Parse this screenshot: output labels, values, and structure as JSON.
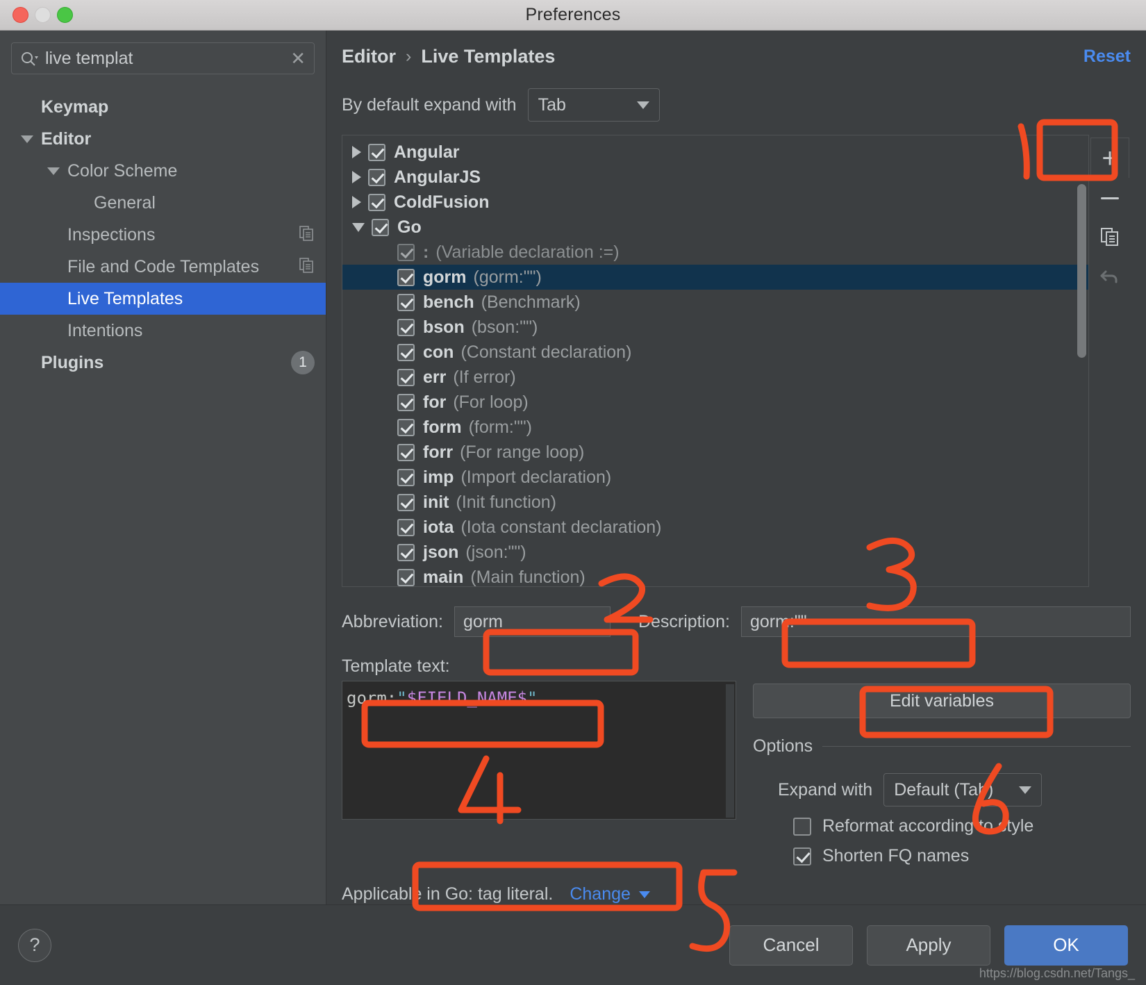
{
  "window": {
    "title": "Preferences"
  },
  "search": {
    "value": "live templat",
    "icon": "search-icon",
    "clear_icon": "clear-icon"
  },
  "sidebar": {
    "items": [
      {
        "label": "Keymap",
        "level": 0,
        "arrow": "none",
        "bold": true,
        "selected": false,
        "icon": ""
      },
      {
        "label": "Editor",
        "level": 0,
        "arrow": "down",
        "bold": true,
        "selected": false,
        "icon": ""
      },
      {
        "label": "Color Scheme",
        "level": 1,
        "arrow": "down",
        "bold": false,
        "selected": false,
        "icon": ""
      },
      {
        "label": "General",
        "level": 2,
        "arrow": "none",
        "bold": false,
        "selected": false,
        "icon": ""
      },
      {
        "label": "Inspections",
        "level": 1,
        "arrow": "none",
        "bold": false,
        "selected": false,
        "icon": "copy-icon"
      },
      {
        "label": "File and Code Templates",
        "level": 1,
        "arrow": "none",
        "bold": false,
        "selected": false,
        "icon": "copy-icon"
      },
      {
        "label": "Live Templates",
        "level": 1,
        "arrow": "none",
        "bold": false,
        "selected": true,
        "icon": ""
      },
      {
        "label": "Intentions",
        "level": 1,
        "arrow": "none",
        "bold": false,
        "selected": false,
        "icon": ""
      },
      {
        "label": "Plugins",
        "level": 0,
        "arrow": "none",
        "bold": true,
        "selected": false,
        "icon": "",
        "badge": "1"
      }
    ]
  },
  "header": {
    "breadcrumb": [
      "Editor",
      "Live Templates"
    ],
    "separator": "›",
    "reset_label": "Reset"
  },
  "expand_default": {
    "label": "By default expand with",
    "value": "Tab"
  },
  "template_list": {
    "rows": [
      {
        "arrow": "right",
        "indent": 0,
        "checked": true,
        "name": "Angular",
        "desc": "",
        "selected": false,
        "muted": false
      },
      {
        "arrow": "right",
        "indent": 0,
        "checked": true,
        "name": "AngularJS",
        "desc": "",
        "selected": false,
        "muted": false
      },
      {
        "arrow": "right",
        "indent": 0,
        "checked": true,
        "name": "ColdFusion",
        "desc": "",
        "selected": false,
        "muted": false
      },
      {
        "arrow": "down",
        "indent": 0,
        "checked": true,
        "name": "Go",
        "desc": "",
        "selected": false,
        "muted": false
      },
      {
        "arrow": "none",
        "indent": 1,
        "checked": true,
        "name": ":",
        "desc": "(Variable declaration :=)",
        "selected": false,
        "muted": true
      },
      {
        "arrow": "none",
        "indent": 1,
        "checked": true,
        "name": "gorm",
        "desc": "(gorm:\"\")",
        "selected": true,
        "muted": false
      },
      {
        "arrow": "none",
        "indent": 1,
        "checked": true,
        "name": "bench",
        "desc": "(Benchmark)",
        "selected": false,
        "muted": false
      },
      {
        "arrow": "none",
        "indent": 1,
        "checked": true,
        "name": "bson",
        "desc": "(bson:\"\")",
        "selected": false,
        "muted": false
      },
      {
        "arrow": "none",
        "indent": 1,
        "checked": true,
        "name": "con",
        "desc": "(Constant declaration)",
        "selected": false,
        "muted": false
      },
      {
        "arrow": "none",
        "indent": 1,
        "checked": true,
        "name": "err",
        "desc": "(If error)",
        "selected": false,
        "muted": false
      },
      {
        "arrow": "none",
        "indent": 1,
        "checked": true,
        "name": "for",
        "desc": "(For loop)",
        "selected": false,
        "muted": false
      },
      {
        "arrow": "none",
        "indent": 1,
        "checked": true,
        "name": "form",
        "desc": "(form:\"\")",
        "selected": false,
        "muted": false
      },
      {
        "arrow": "none",
        "indent": 1,
        "checked": true,
        "name": "forr",
        "desc": "(For range loop)",
        "selected": false,
        "muted": false
      },
      {
        "arrow": "none",
        "indent": 1,
        "checked": true,
        "name": "imp",
        "desc": "(Import declaration)",
        "selected": false,
        "muted": false
      },
      {
        "arrow": "none",
        "indent": 1,
        "checked": true,
        "name": "init",
        "desc": "(Init function)",
        "selected": false,
        "muted": false
      },
      {
        "arrow": "none",
        "indent": 1,
        "checked": true,
        "name": "iota",
        "desc": "(Iota constant declaration)",
        "selected": false,
        "muted": false
      },
      {
        "arrow": "none",
        "indent": 1,
        "checked": true,
        "name": "json",
        "desc": "(json:\"\")",
        "selected": false,
        "muted": false
      },
      {
        "arrow": "none",
        "indent": 1,
        "checked": true,
        "name": "main",
        "desc": "(Main function)",
        "selected": false,
        "muted": false
      }
    ]
  },
  "toolbar": {
    "add_icon": "plus-icon",
    "remove_icon": "minus-icon",
    "duplicate_icon": "copy-icon",
    "revert_icon": "undo-icon"
  },
  "form": {
    "abbreviation_label": "Abbreviation:",
    "abbreviation_value": "gorm",
    "description_label": "Description:",
    "description_value": "gorm:\"\"",
    "template_text_label": "Template text:",
    "template_code": {
      "prefix": "gorm:",
      "quote_open": "\"",
      "variable": "$FIELD_NAME$",
      "quote_close": "\""
    },
    "edit_variables_label": "Edit variables",
    "options_label": "Options",
    "expand_with_label": "Expand with",
    "expand_with_value": "Default (Tab)",
    "reformat_label": "Reformat according to style",
    "reformat_checked": false,
    "shorten_label": "Shorten FQ names",
    "shorten_checked": true,
    "applicable_text": "Applicable in Go: tag literal.",
    "change_label": "Change"
  },
  "footer": {
    "help_label": "?",
    "cancel_label": "Cancel",
    "apply_label": "Apply",
    "ok_label": "OK"
  },
  "watermark": "https://blog.csdn.net/Tangs_",
  "annotations": {
    "color": "#f04a22",
    "marks": [
      "1",
      "2",
      "3",
      "4",
      "5",
      "6"
    ]
  }
}
